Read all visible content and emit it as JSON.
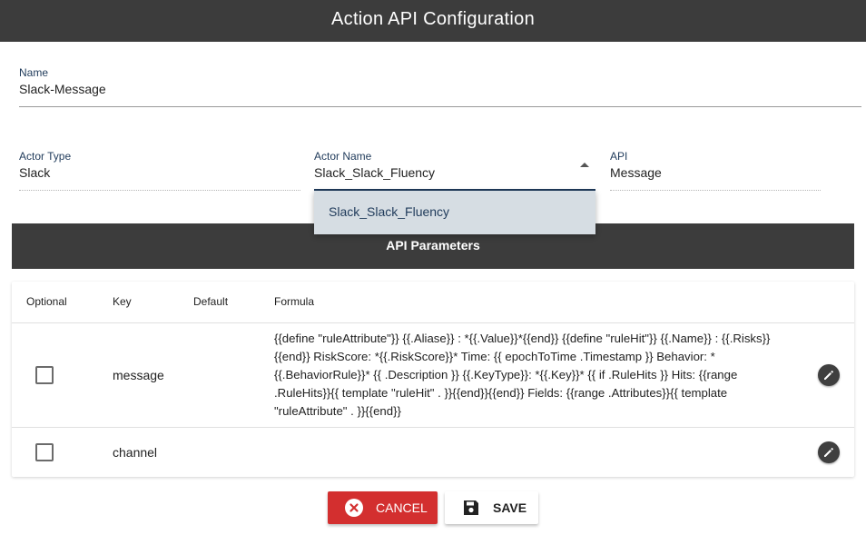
{
  "header": {
    "title": "Action API Configuration"
  },
  "form": {
    "name": {
      "label": "Name",
      "value": "Slack-Message"
    },
    "actor_type": {
      "label": "Actor Type",
      "value": "Slack"
    },
    "actor_name": {
      "label": "Actor Name",
      "value": "Slack_Slack_Fluency",
      "options": [
        "Slack_Slack_Fluency"
      ]
    },
    "api": {
      "label": "API",
      "value": "Message"
    }
  },
  "params": {
    "title": "API Parameters",
    "columns": [
      "Optional",
      "Key",
      "Default",
      "Formula"
    ],
    "rows": [
      {
        "optional": false,
        "key": "message",
        "default": "",
        "formula": "{{define \"ruleAttribute\"}} {{.Aliase}} : *{{.Value}}*{{end}} {{define \"ruleHit\"}} {{.Name}} : {{.Risks}}{{end}} RiskScore: *{{.RiskScore}}* Time: {{ epochToTime .Timestamp }} Behavior: *{{.BehaviorRule}}* {{ .Description }} {{.KeyType}}: *{{.Key}}* {{ if .RuleHits }} Hits: {{range .RuleHits}}{{ template \"ruleHit\" . }}{{end}}{{end}} Fields: {{range .Attributes}}{{ template \"ruleAttribute\" . }}{{end}}"
      },
      {
        "optional": false,
        "key": "channel",
        "default": "",
        "formula": ""
      }
    ]
  },
  "actions": {
    "cancel_label": "CANCEL",
    "save_label": "SAVE"
  },
  "icons": {
    "cancel": "cancel-circle-icon",
    "save": "floppy-disk-icon",
    "edit": "pencil-icon",
    "dropdown": "caret-up-icon"
  },
  "colors": {
    "header_bg": "#3c3c3c",
    "accent": "#1f3a5a",
    "cancel": "#d32f2f",
    "selected_option": "#d6dde3"
  }
}
